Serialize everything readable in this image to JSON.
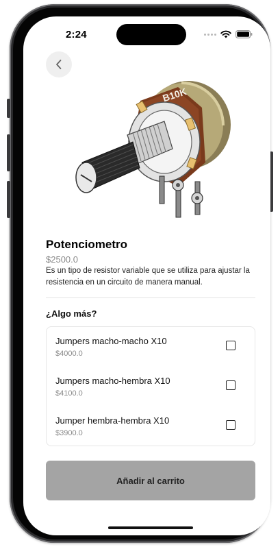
{
  "status_bar": {
    "time": "2:24",
    "icons": [
      "signal-dots-icon",
      "wifi-icon",
      "battery-icon"
    ]
  },
  "nav": {
    "back_icon": "chevron-left-icon"
  },
  "product": {
    "image_label": "B10K",
    "name": "Potenciometro",
    "price": "$2500.0",
    "description": "Es un tipo de resistor variable que se utiliza para ajustar la resistencia en un circuito de manera manual."
  },
  "addons": {
    "title": "¿Algo más?",
    "items": [
      {
        "name": "Jumpers macho-macho X10",
        "price": "$4000.0",
        "checked": false
      },
      {
        "name": "Jumpers macho-hembra X10",
        "price": "$4100.0",
        "checked": false
      },
      {
        "name": "Jumper hembra-hembra X10",
        "price": "$3900.0",
        "checked": false
      }
    ]
  },
  "cta": {
    "label": "Añadir al carrito"
  },
  "colors": {
    "cta_background": "#a4a4a4",
    "price_text": "#8a8a8a",
    "back_button_bg": "#efefef"
  }
}
